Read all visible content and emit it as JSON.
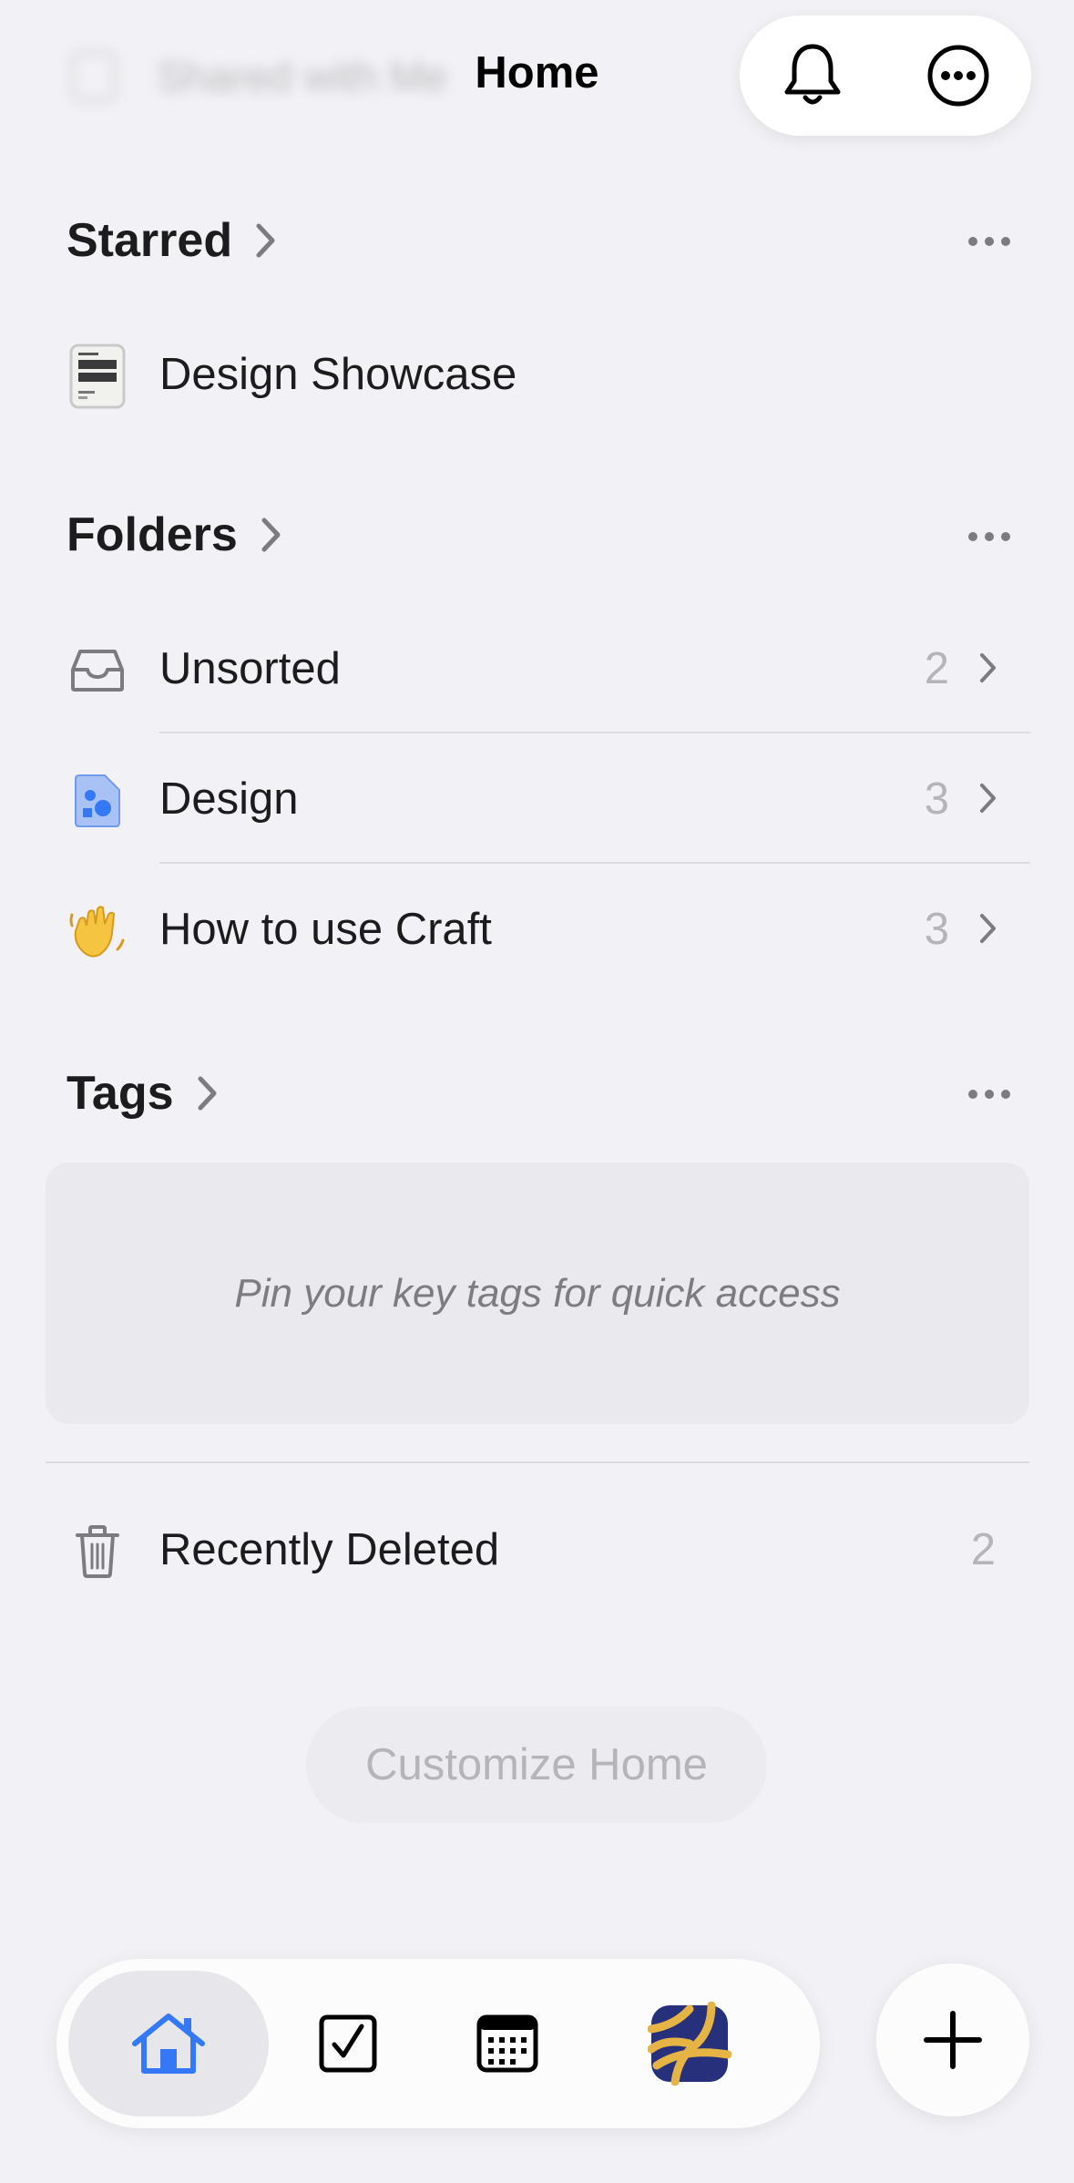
{
  "header": {
    "background_item": "Shared with Me",
    "title": "Home",
    "bell_icon": "bell-icon",
    "more_icon": "ellipsis-circle-icon"
  },
  "starred": {
    "title": "Starred",
    "items": [
      {
        "label": "Design Showcase",
        "icon": "document-thumbnail-icon"
      }
    ]
  },
  "folders": {
    "title": "Folders",
    "items": [
      {
        "label": "Unsorted",
        "count": "2",
        "icon": "inbox-tray-icon"
      },
      {
        "label": "Design",
        "count": "3",
        "icon": "shapes-document-icon"
      },
      {
        "label": "How to use Craft",
        "count": "3",
        "icon": "waving-hand-icon"
      }
    ]
  },
  "tags": {
    "title": "Tags",
    "empty_text": "Pin your key tags for quick access"
  },
  "recently_deleted": {
    "label": "Recently Deleted",
    "count": "2"
  },
  "customize_label": "Customize Home",
  "tabbar": {
    "tabs": [
      "home",
      "tasks",
      "calendar",
      "space"
    ]
  },
  "colors": {
    "accent": "#3478f6",
    "background": "#f2f2f6",
    "muted_text": "#b4b4ba",
    "space_logo_blue": "#27307a",
    "space_logo_gold": "#e6b444"
  }
}
